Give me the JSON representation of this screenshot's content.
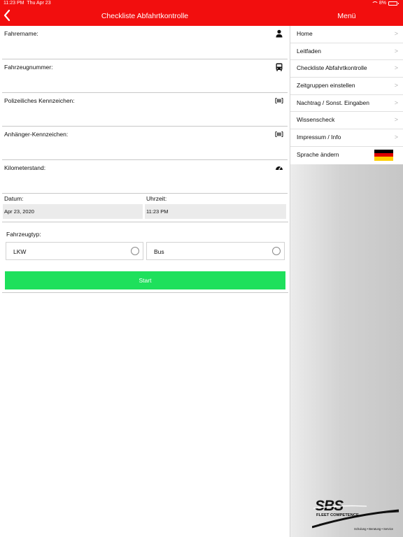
{
  "status": {
    "time": "11:23 PM",
    "date": "Thu Apr 23",
    "battery": "8%"
  },
  "header": {
    "title": "Checkliste Abfahrtkontrolle",
    "menu_title": "Menü",
    "back_icon": "chevron-left-icon"
  },
  "form": {
    "fields": [
      {
        "label": "Fahrername:",
        "icon": "person-icon"
      },
      {
        "label": "Fahrzeugnummer:",
        "icon": "bus-icon"
      },
      {
        "label": "Polizeiliches Kennzeichen:",
        "icon": "barcode-icon"
      },
      {
        "label": "Anhänger-Kennzeichen:",
        "icon": "barcode-icon"
      },
      {
        "label": "Kilometerstand:",
        "icon": "speedometer-icon"
      }
    ],
    "date_label": "Datum:",
    "date_value": "Apr 23, 2020",
    "time_label": "Uhrzeit:",
    "time_value": "11:23 PM",
    "vehicle_type_label": "Fahrzeugtyp:",
    "vehicle_types": [
      "LKW",
      "Bus"
    ],
    "start_label": "Start"
  },
  "menu": {
    "items": [
      "Home",
      "Leitfaden",
      "Checkliste Abfahrtkontrolle",
      "Zeitgruppen einstellen",
      "Nachtrag / Sonst. Eingaben",
      "Wissenscheck",
      "Impressum / Info"
    ],
    "language_label": "Sprache ändern",
    "flag_icon": "german-flag-icon"
  },
  "logo": {
    "name": "SBS",
    "subtitle": "FLEET COMPETENCE",
    "tagline": "Schulung • Beratung • Service"
  },
  "colors": {
    "header": "#f20e0e",
    "start_button": "#1ee05c"
  }
}
